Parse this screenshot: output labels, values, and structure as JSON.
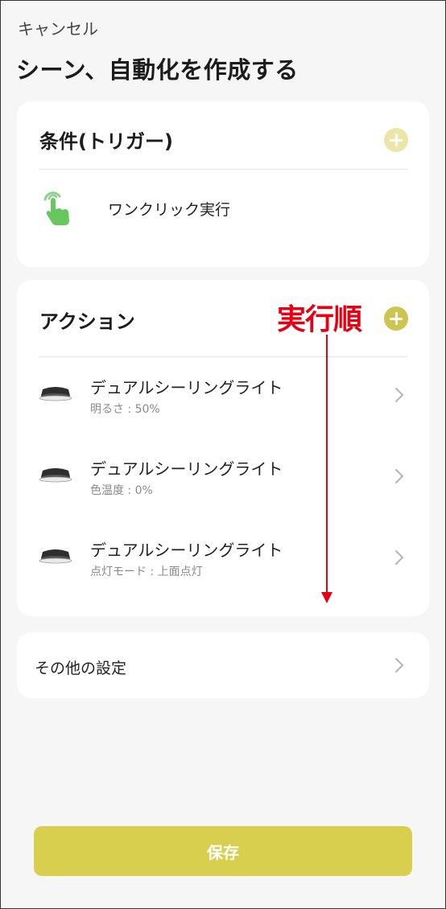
{
  "header": {
    "cancel_label": "キャンセル",
    "title": "シーン、自動化を作成する"
  },
  "trigger_card": {
    "title": "条件(トリガー)",
    "item_label": "ワンクリック実行",
    "icon": "tap-hand-icon"
  },
  "action_card": {
    "title": "アクション",
    "annotation": "実行順",
    "items": [
      {
        "name": "デュアルシーリングライト",
        "detail": "明るさ : 50%",
        "icon": "ceiling-light-icon"
      },
      {
        "name": "デュアルシーリングライト",
        "detail": "色温度 : 0%",
        "icon": "ceiling-light-icon"
      },
      {
        "name": "デュアルシーリングライト",
        "detail": "点灯モード : 上面点灯",
        "icon": "ceiling-light-icon"
      }
    ]
  },
  "other_settings": {
    "label": "その他の設定"
  },
  "footer": {
    "save_label": "保存"
  },
  "colors": {
    "accent": "#d9cf4e",
    "accent_light": "#ebe6a8",
    "annotation_red": "#e60012",
    "background": "#f6f6f6"
  }
}
